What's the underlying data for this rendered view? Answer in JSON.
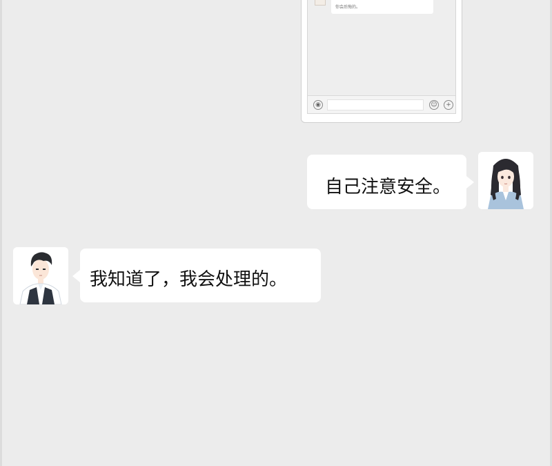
{
  "embedded_screenshot": {
    "message_text": "你会后悔的。",
    "icons": {
      "voice": "voice-icon",
      "emoji": "emoji-icon",
      "plus": "plus-icon"
    },
    "voice_glyph": "◉",
    "emoji_glyph": "☺",
    "plus_glyph": "+"
  },
  "messages": [
    {
      "sender": "girl",
      "side": "right",
      "text": "自己注意安全。"
    },
    {
      "sender": "boy",
      "side": "left",
      "text": "我知道了，我会处理的。"
    }
  ],
  "colors": {
    "background": "#ececec",
    "bubble": "#ffffff",
    "text": "#111111"
  }
}
